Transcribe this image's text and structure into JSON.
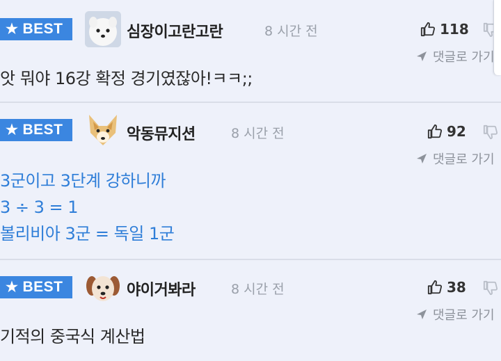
{
  "colors": {
    "background": "#eef1fa",
    "badge": "#3b86e0",
    "blue_text": "#2f7ed8",
    "muted": "#9aa0aa"
  },
  "comments": [
    {
      "badge": "BEST",
      "avatar": "white-dog-avatar",
      "nickname": "심장이고란고란",
      "time": "8 시간 전",
      "likes": "118",
      "reply": "댓글로 가기",
      "lines": [
        "앗 뭐야 16강 확정 경기였잖아!ㅋㅋ;;"
      ]
    },
    {
      "badge": "BEST",
      "avatar": "fox-avatar",
      "nickname": "악동뮤지션",
      "time": "8 시간 전",
      "likes": "92",
      "reply": "댓글로 가기",
      "lines": [
        "3군이고 3단계 강하니까",
        "3 ÷ 3 = 1",
        "볼리비아 3군 = 독일 1군"
      ]
    },
    {
      "badge": "BEST",
      "avatar": "puppy-avatar",
      "nickname": "야이거봐라",
      "time": "8 시간 전",
      "likes": "38",
      "reply": "댓글로 가기",
      "lines": [
        "기적의 중국식 계산법"
      ]
    }
  ]
}
